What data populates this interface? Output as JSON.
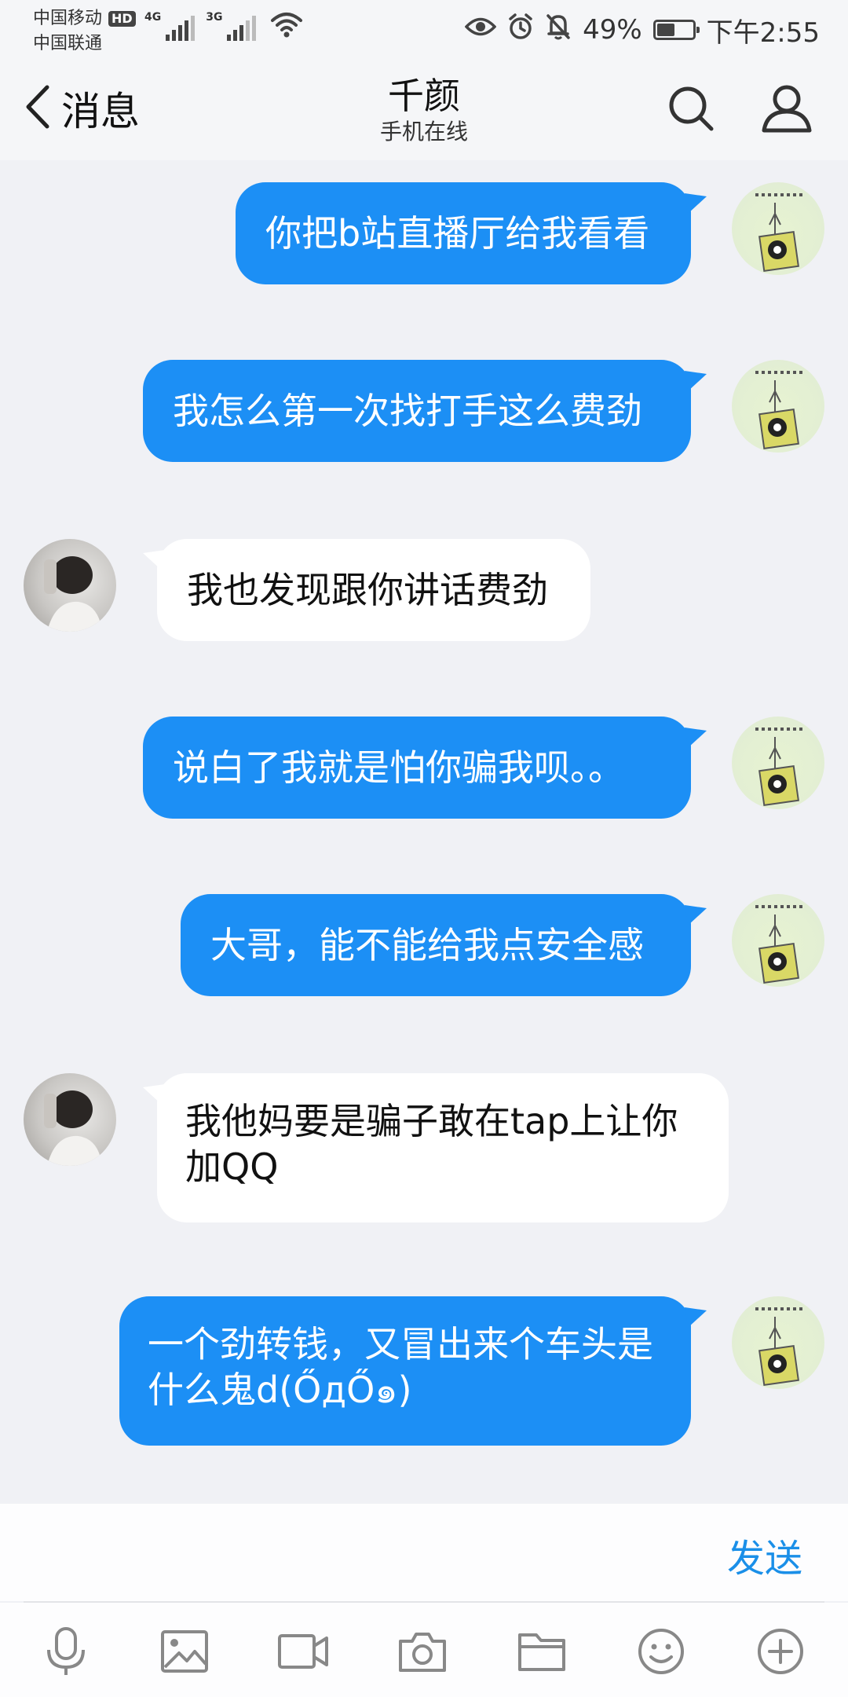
{
  "status_bar": {
    "carrier_1": "中国移动",
    "carrier_1_badge": "HD",
    "carrier_2": "中国联通",
    "network_1": "4G",
    "network_2": "3G",
    "battery_percent": "49%",
    "battery_level": 0.49,
    "time": "下午2:55",
    "icons": [
      "eye-comfort-icon",
      "alarm-icon",
      "mute-notification-icon",
      "battery-icon"
    ]
  },
  "header": {
    "back_label": "消息",
    "title": "千颜",
    "subtitle": "手机在线",
    "icons": [
      "search-icon",
      "profile-icon"
    ]
  },
  "messages": [
    {
      "side": "out",
      "text": "你把b站直播厅给我看看"
    },
    {
      "side": "out",
      "text": "我怎么第一次找打手这么费劲"
    },
    {
      "side": "in",
      "text": "我也发现跟你讲话费劲"
    },
    {
      "side": "out",
      "text": "说白了我就是怕你骗我呗。。"
    },
    {
      "side": "out",
      "text": "大哥，能不能给我点安全感"
    },
    {
      "side": "in",
      "text": "我他妈要是骗子敢在tap上让你加QQ"
    },
    {
      "side": "out",
      "text": "一个劲转钱，又冒出来个车头是什么鬼d(ŐдŐ๑)"
    }
  ],
  "input": {
    "value": "",
    "send_label": "发送"
  },
  "toolbar": {
    "icons": [
      "microphone-icon",
      "image-icon",
      "video-icon",
      "camera-icon",
      "folder-icon",
      "emoji-icon",
      "plus-icon"
    ]
  },
  "colors": {
    "outgoing_bubble": "#1c8ff5",
    "incoming_bubble": "#ffffff",
    "chat_background": "#f0f1f5",
    "send_link": "#1a8fe8"
  }
}
